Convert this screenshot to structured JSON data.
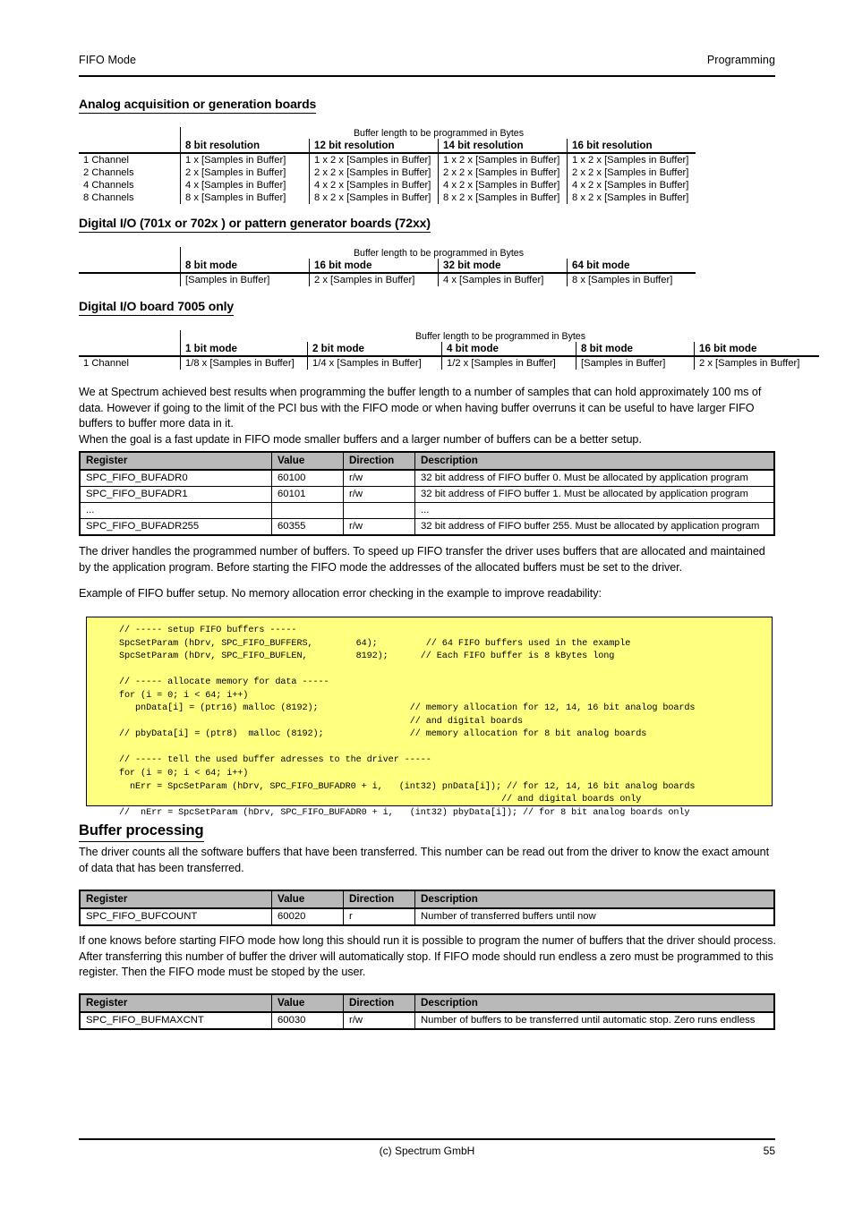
{
  "header": {
    "left": "FIFO Mode",
    "right": "Programming"
  },
  "sections": {
    "analog": {
      "heading": "Analog acquisition or generation boards",
      "caption": "Buffer length to be programmed in Bytes",
      "columns": [
        "8 bit resolution",
        "12 bit resolution",
        "14 bit resolution",
        "16 bit resolution"
      ],
      "rows": [
        {
          "label": "1 Channel",
          "cells": [
            "1 x [Samples in Buffer]",
            "1 x 2 x [Samples in Buffer]",
            "1 x 2 x [Samples in Buffer]",
            "1 x 2 x [Samples in Buffer]"
          ]
        },
        {
          "label": "2 Channels",
          "cells": [
            "2 x [Samples in Buffer]",
            "2 x 2 x [Samples in Buffer]",
            "2 x 2 x [Samples in Buffer]",
            "2 x 2 x [Samples in Buffer]"
          ]
        },
        {
          "label": "4 Channels",
          "cells": [
            "4 x [Samples in Buffer]",
            "4 x 2 x [Samples in Buffer]",
            "4 x 2 x [Samples in Buffer]",
            "4 x 2 x [Samples in Buffer]"
          ]
        },
        {
          "label": "8 Channels",
          "cells": [
            "8 x [Samples in Buffer]",
            "8 x 2 x [Samples in Buffer]",
            "8 x 2 x [Samples in Buffer]",
            "8 x 2 x [Samples in Buffer]"
          ]
        }
      ]
    },
    "digital_io": {
      "heading": "Digital I/O (701x or 702x ) or pattern generator boards (72xx)",
      "caption": "Buffer length to be programmed in Bytes",
      "columns": [
        "8 bit mode",
        "16 bit mode",
        "32 bit mode",
        "64 bit mode"
      ],
      "rows": [
        {
          "label": "",
          "cells": [
            "[Samples in Buffer]",
            "2 x [Samples in Buffer]",
            "4 x [Samples in Buffer]",
            "8 x [Samples in Buffer]"
          ]
        }
      ]
    },
    "board7005": {
      "heading": "Digital I/O board 7005 only",
      "caption": "Buffer length to be programmed in Bytes",
      "columns": [
        "1 bit mode",
        "2 bit mode",
        "4 bit mode",
        "8 bit mode",
        "16 bit mode"
      ],
      "rows": [
        {
          "label": "1 Channel",
          "cells": [
            "1/8 x [Samples in Buffer]",
            "1/4 x [Samples in Buffer]",
            "1/2 x [Samples in Buffer]",
            "[Samples in Buffer]",
            "2 x [Samples in Buffer]"
          ]
        }
      ]
    }
  },
  "paragraphs": {
    "best_results": "We at Spectrum achieved best results when programming the buffer length to a number of samples that can hold approximately 100 ms of data. However if going to the limit of the PCI bus with the FIFO mode or when having buffer overruns it can be useful to have larger FIFO buffers to buffer more data in it.\nWhen the goal is a fast update in FIFO mode smaller buffers and a larger number of buffers can be a better setup.",
    "driver_handles": "The driver handles the programmed number of buffers. To speed up FIFO transfer the driver uses buffers that are allocated and maintained by the application program. Before starting the FIFO mode the addresses of the allocated buffers must be set to the driver.",
    "example_intro": "Example of FIFO buffer setup. No memory allocation error checking in the example to improve readability:",
    "buffer_processing_intro": "The driver counts all the software buffers that have been transferred. This number can be read out from the driver to know the exact amount of data that has been transferred.",
    "bufmaxcnt_intro": "If one knows before starting FIFO mode how long this should run it is possible to program the numer of buffers that the driver should process. After transferring this number of buffer the driver will automatically stop. If FIFO mode should run endless a zero must be programmed to this register. Then the FIFO mode must be stoped by the user."
  },
  "reg_table_headers": [
    "Register",
    "Value",
    "Direction",
    "Description"
  ],
  "bufadr_table": {
    "rows": [
      [
        "SPC_FIFO_BUFADR0",
        "60100",
        "r/w",
        "32 bit address of FIFO buffer 0. Must be allocated by application program"
      ],
      [
        "SPC_FIFO_BUFADR1",
        "60101",
        "r/w",
        "32 bit address of FIFO buffer 1. Must be allocated by application program"
      ],
      [
        "...",
        "",
        "",
        "..."
      ],
      [
        "SPC_FIFO_BUFADR255",
        "60355",
        "r/w",
        "32 bit address of FIFO buffer 255. Must be allocated by application program"
      ]
    ]
  },
  "bufcount_table": {
    "rows": [
      [
        "SPC_FIFO_BUFCOUNT",
        "60020",
        "r",
        "Number of transferred buffers until now"
      ]
    ]
  },
  "bufmaxcnt_table": {
    "rows": [
      [
        "SPC_FIFO_BUFMAXCNT",
        "60030",
        "r/w",
        "Number of buffers to be transferred until automatic stop. Zero runs endless"
      ]
    ]
  },
  "code_example": "// ----- setup FIFO buffers -----\nSpcSetParam (hDrv, SPC_FIFO_BUFFERS,        64);         // 64 FIFO buffers used in the example\nSpcSetParam (hDrv, SPC_FIFO_BUFLEN,         8192);      // Each FIFO buffer is 8 kBytes long\n\n// ----- allocate memory for data -----\nfor (i = 0; i < 64; i++)\n   pnData[i] = (ptr16) malloc (8192);                 // memory allocation for 12, 14, 16 bit analog boards\n                                                      // and digital boards\n// pbyData[i] = (ptr8)  malloc (8192);                // memory allocation for 8 bit analog boards\n\n// ----- tell the used buffer adresses to the driver -----\nfor (i = 0; i < 64; i++)\n  nErr = SpcSetParam (hDrv, SPC_FIFO_BUFADR0 + i,   (int32) pnData[i]); // for 12, 14, 16 bit analog boards\n                                                                       // and digital boards only\n//  nErr = SpcSetParam (hDrv, SPC_FIFO_BUFADR0 + i,   (int32) pbyData[i]); // for 8 bit analog boards only",
  "buffer_processing_heading": "Buffer processing",
  "footer": {
    "copyright": "(c) Spectrum GmbH",
    "page_number": "55"
  }
}
